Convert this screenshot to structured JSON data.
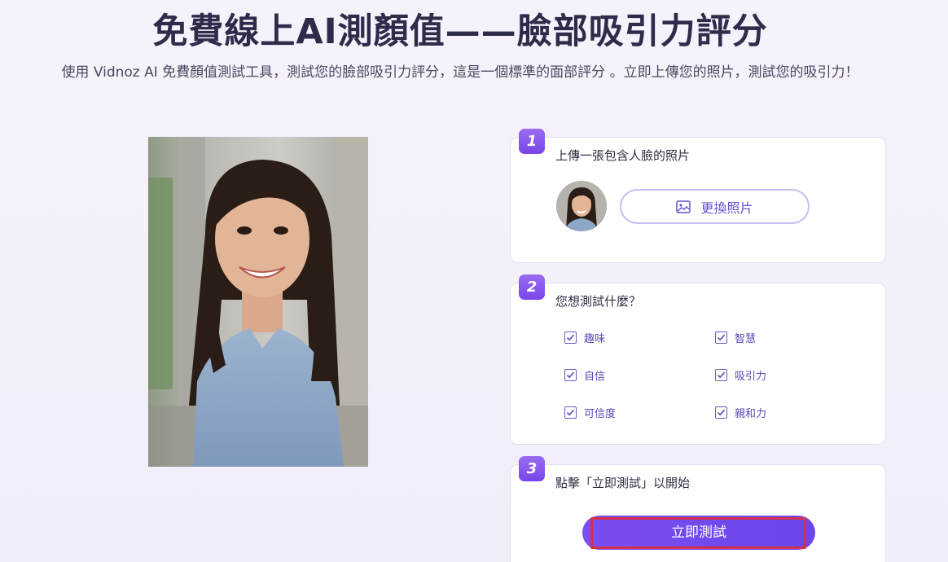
{
  "page": {
    "title": "免費線上AI測顏值——臉部吸引力評分",
    "subtitle": "使用 Vidnoz AI 免費顏值測試工具，測試您的臉部吸引力評分，這是一個標準的面部評分 。立即上傳您的照片，測試您的吸引力！"
  },
  "steps": [
    {
      "number": "1",
      "title": "上傳一張包含人臉的照片",
      "button_label": "更換照片",
      "button_icon": "image-icon"
    },
    {
      "number": "2",
      "title": "您想測試什麼？",
      "options": [
        {
          "label": "趣味",
          "checked": true
        },
        {
          "label": "智慧",
          "checked": true
        },
        {
          "label": "自信",
          "checked": true
        },
        {
          "label": "吸引力",
          "checked": true
        },
        {
          "label": "可信度",
          "checked": true
        },
        {
          "label": "親和力",
          "checked": true
        }
      ]
    },
    {
      "number": "3",
      "title": "點擊「立即測試」以開始",
      "button_label": "立即測試"
    }
  ],
  "colors": {
    "accent": "#7a4cf0",
    "highlight_outline": "#d2324b"
  }
}
